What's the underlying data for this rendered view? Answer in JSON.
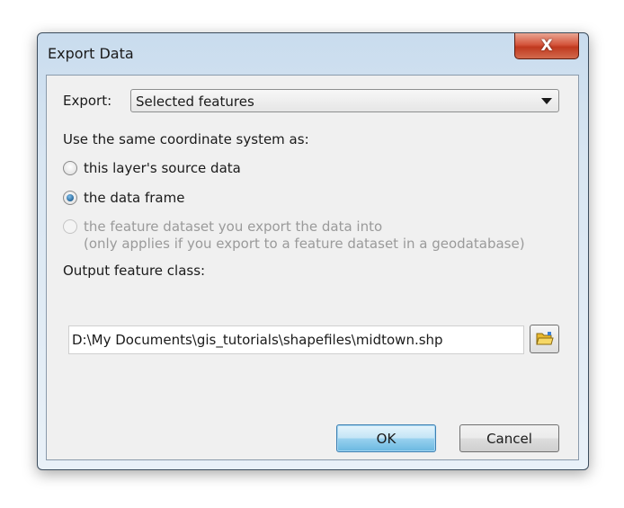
{
  "window": {
    "title": "Export Data",
    "close_label": "X"
  },
  "export": {
    "label": "Export:",
    "selected": "Selected features"
  },
  "coordinate": {
    "heading": "Use the same coordinate system as:",
    "options": [
      {
        "label": "this layer's source data",
        "checked": false,
        "enabled": true
      },
      {
        "label": "the data frame",
        "checked": true,
        "enabled": true
      },
      {
        "label": "the feature dataset you export the data into",
        "note": "(only applies if you export to a feature dataset in a geodatabase)",
        "checked": false,
        "enabled": false
      }
    ]
  },
  "output": {
    "label": "Output feature class:",
    "value": "D:\\My Documents\\gis_tutorials\\shapefiles\\midtown.shp",
    "browse_icon": "folder-open-icon"
  },
  "buttons": {
    "ok": "OK",
    "cancel": "Cancel"
  }
}
